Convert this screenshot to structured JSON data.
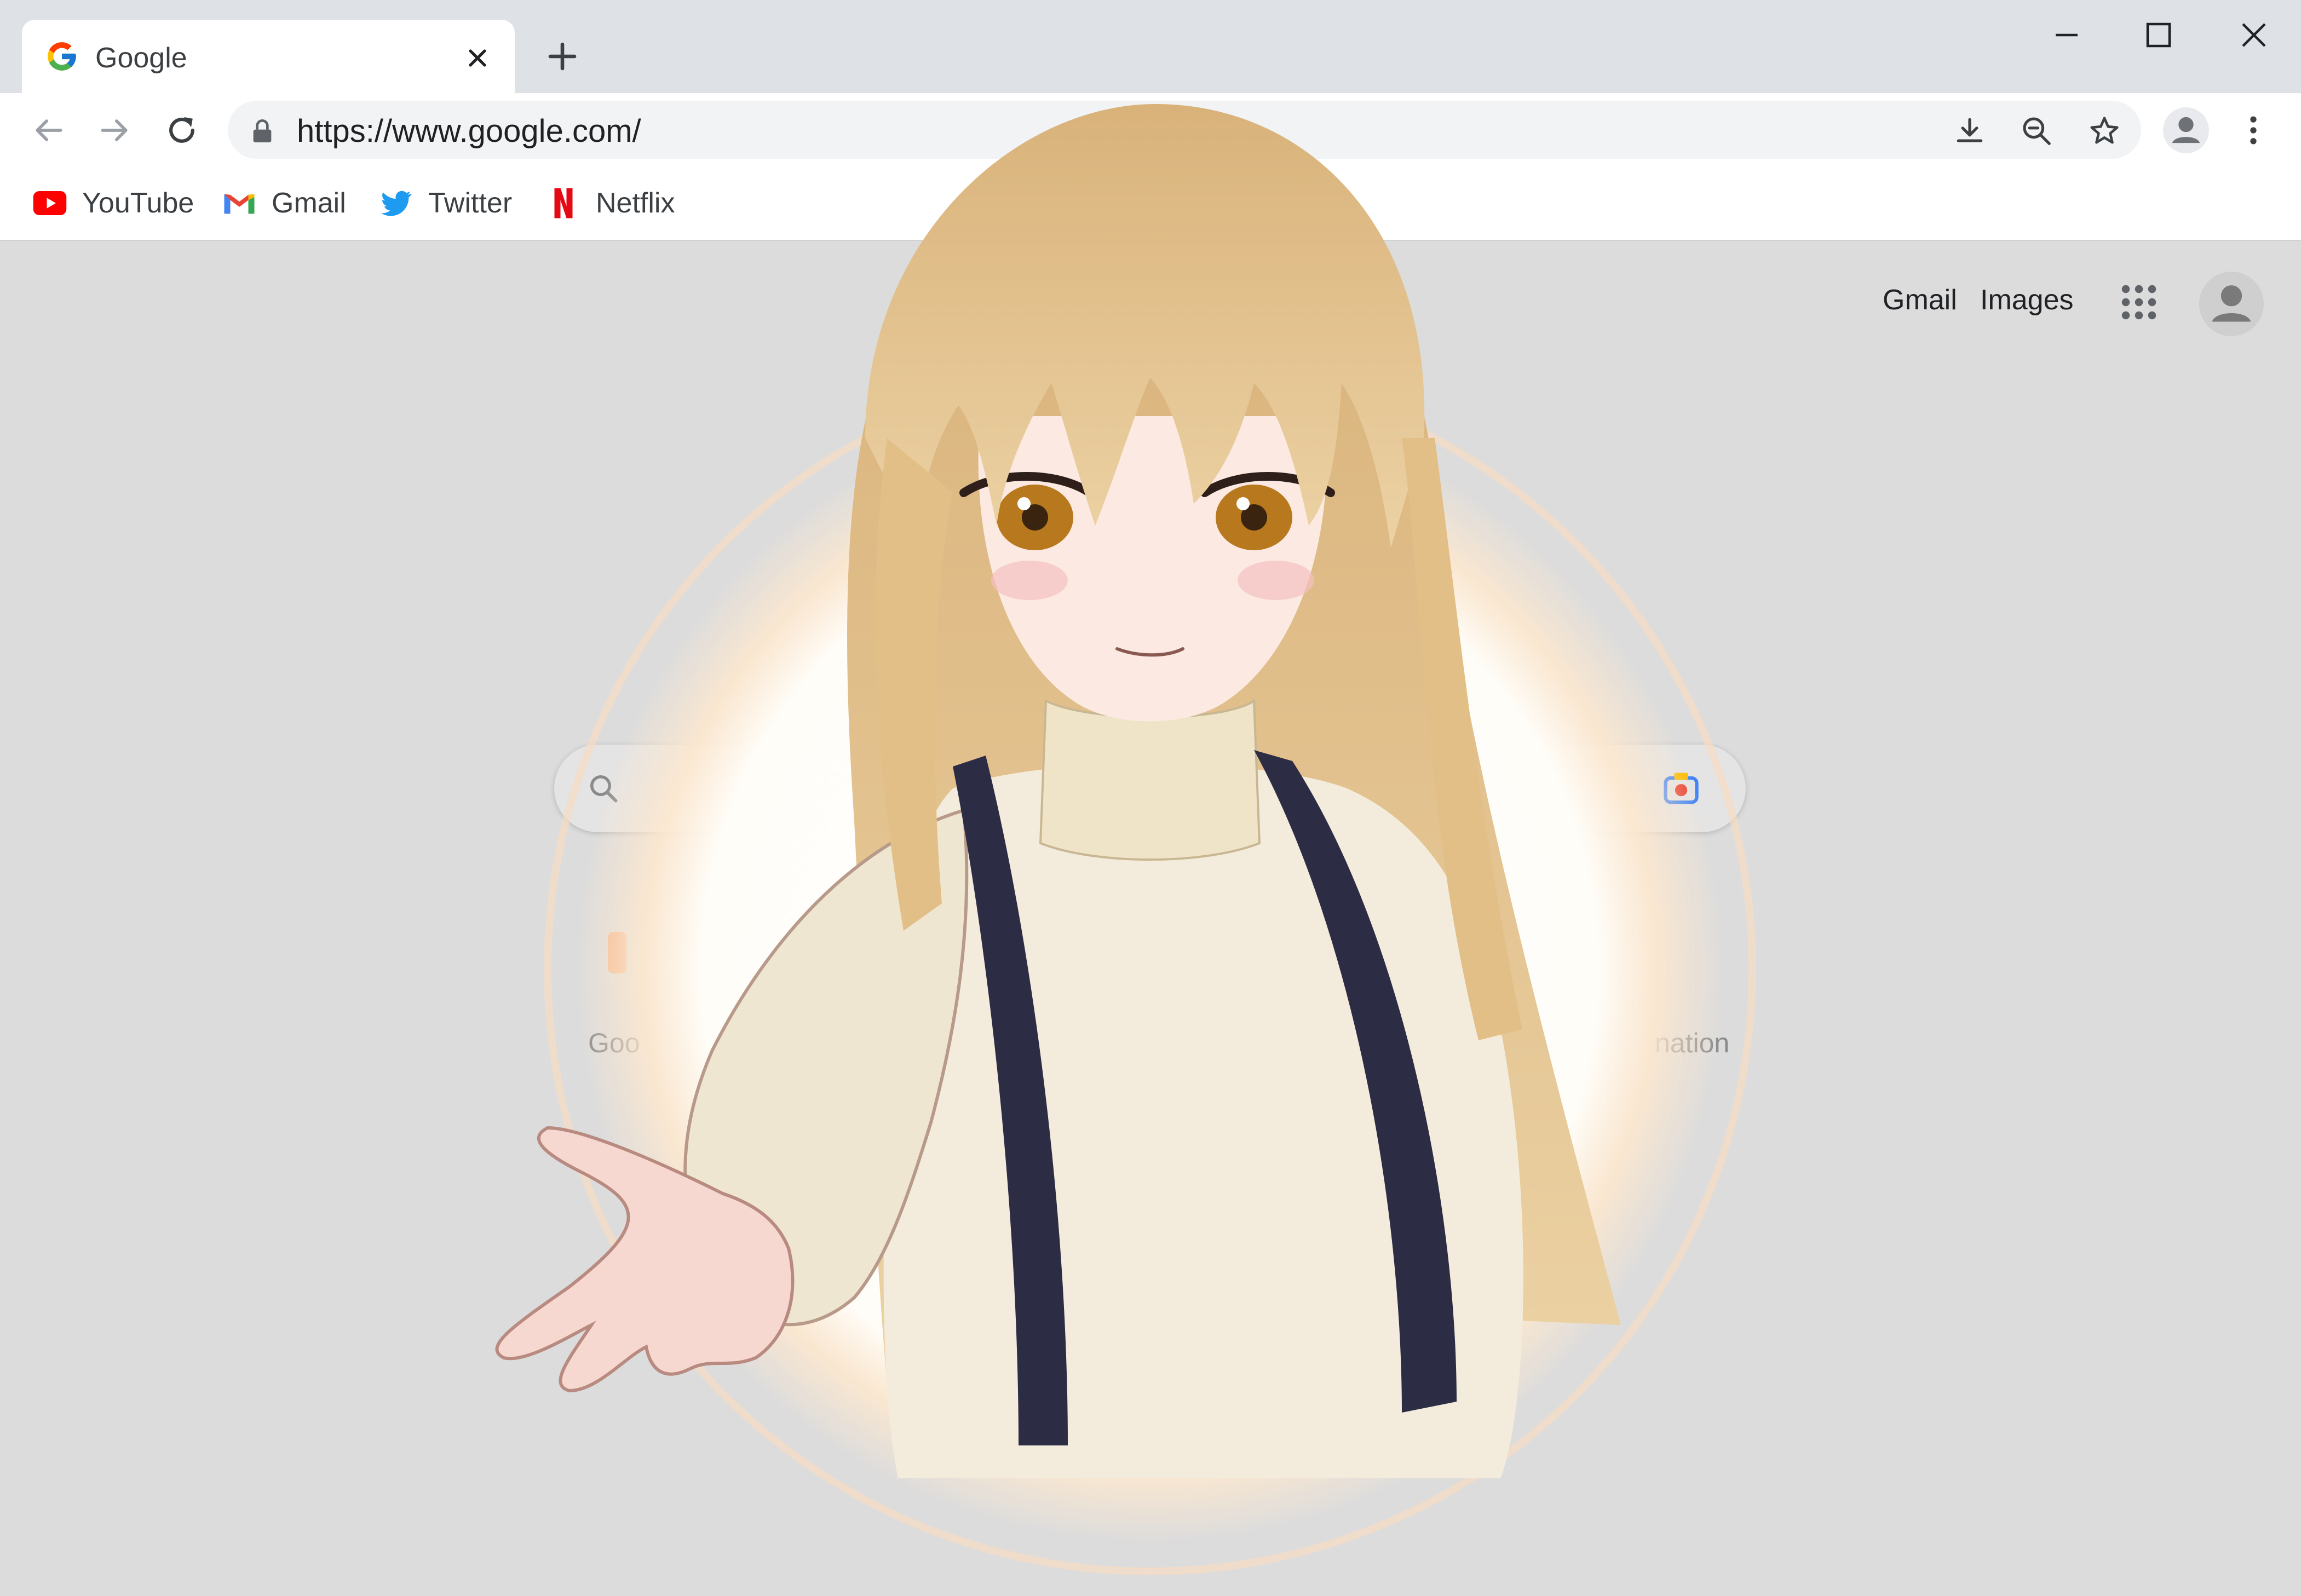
{
  "tab": {
    "title": "Google",
    "close_label": "×"
  },
  "omnibox": {
    "url": "https://www.google.com/"
  },
  "bookmarks": [
    {
      "label": "YouTube",
      "icon": "youtube-icon"
    },
    {
      "label": "Gmail",
      "icon": "gmail-icon"
    },
    {
      "label": "Twitter",
      "icon": "twitter-icon"
    },
    {
      "label": "Netflix",
      "icon": "netflix-icon"
    }
  ],
  "page": {
    "top_links": [
      {
        "label": "Gmail"
      },
      {
        "label": "Images"
      }
    ],
    "shortcuts": [
      {
        "label": "Goo"
      },
      {
        "label": "nation"
      }
    ]
  },
  "colors": {
    "tabstrip": "#dee1e6",
    "page_background": "#dcdcdc",
    "hair": "#e3bf88",
    "sweater": "#f3ecdc",
    "suspenders": "#2c2c45",
    "eyes": "#b8781e"
  },
  "icons": [
    "google-icon",
    "close-icon",
    "plus-icon",
    "minimize-icon",
    "maximize-icon",
    "window-close-icon",
    "back-arrow-icon",
    "forward-arrow-icon",
    "reload-icon",
    "lock-icon",
    "download-icon",
    "zoom-out-icon",
    "star-icon",
    "avatar-icon",
    "more-vert-icon",
    "apps-grid-icon",
    "search-icon",
    "camera-lens-icon"
  ]
}
